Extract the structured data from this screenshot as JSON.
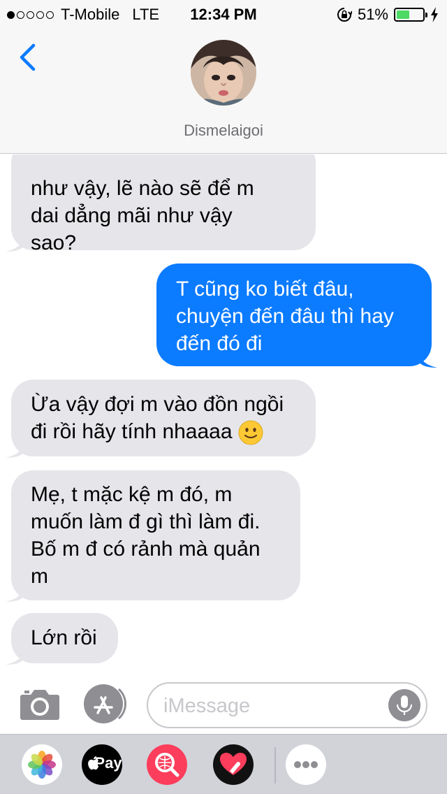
{
  "status_bar": {
    "carrier": "T-Mobile",
    "network": "LTE",
    "time": "12:34 PM",
    "battery_percent": "51%",
    "battery_level": 0.51,
    "signal_bars_filled": 1,
    "signal_bars_total": 5
  },
  "header": {
    "contact_name": "Dismelaigoi",
    "back_icon": "chevron-left-icon"
  },
  "messages": [
    {
      "direction": "incoming",
      "lines": [
        "như vậy, lẽ nào sẽ để m",
        "dai dẳng mãi như vậy",
        "sao?"
      ]
    },
    {
      "direction": "outgoing",
      "lines": [
        "T cũng ko biết đâu,",
        "chuyện đến đâu thì hay",
        "đến đó đi"
      ]
    },
    {
      "direction": "incoming",
      "lines": [
        "Ừa vậy đợi m vào đồn ngồi",
        "đi rồi hãy tính nhaaaa"
      ],
      "emoji": "slightly-smiling-face"
    },
    {
      "direction": "incoming",
      "lines": [
        "Mẹ, t mặc kệ m đó, m",
        "muốn làm đ gì thì làm đi.",
        "Bố m đ có rảnh mà quản",
        "m"
      ]
    },
    {
      "direction": "incoming",
      "lines": [
        "Lớn rồi"
      ]
    }
  ],
  "input_bar": {
    "placeholder": "iMessage",
    "value": ""
  },
  "app_drawer": {
    "apple_pay_label": "Pay",
    "apps": [
      "photos-app-icon",
      "apple-pay-icon",
      "image-search-icon",
      "digital-touch-icon",
      "more-apps-icon"
    ]
  },
  "colors": {
    "incoming_bubble": "#e5e5ea",
    "outgoing_bubble": "#0b7bff",
    "accent": "#0b7bff",
    "battery": "#4cd964"
  }
}
